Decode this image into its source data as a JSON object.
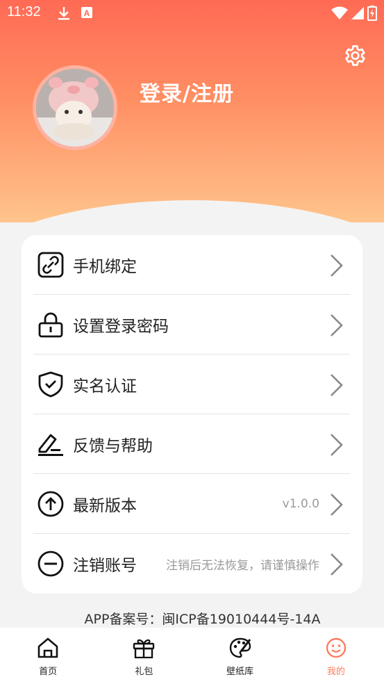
{
  "status_bar": {
    "time": "11:32",
    "a_label": "A"
  },
  "profile": {
    "login_label": "登录/注册"
  },
  "menu": [
    {
      "label": "手机绑定",
      "value": ""
    },
    {
      "label": "设置登录密码",
      "value": ""
    },
    {
      "label": "实名认证",
      "value": ""
    },
    {
      "label": "反馈与帮助",
      "value": ""
    },
    {
      "label": "最新版本",
      "value": "v1.0.0"
    },
    {
      "label": "注销账号",
      "value": "注销后无法恢复，请谨慎操作"
    }
  ],
  "footer": {
    "icp": "APP备案号：闽ICP备19010444号-14A"
  },
  "tabs": [
    {
      "label": "首页"
    },
    {
      "label": "礼包"
    },
    {
      "label": "壁纸库"
    },
    {
      "label": "我的"
    }
  ],
  "colors": {
    "accent": "#ff7b5f",
    "header_top": "#ff6a55",
    "header_bottom": "#ffc48c"
  }
}
